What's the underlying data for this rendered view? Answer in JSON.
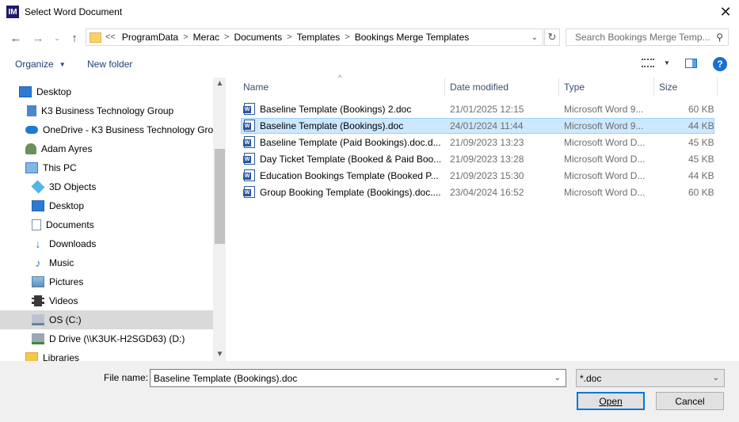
{
  "window": {
    "title": "Select Word Document",
    "app_icon": "IM"
  },
  "address": {
    "overflow": "<<",
    "crumbs": [
      "ProgramData",
      "Merac",
      "Documents",
      "Templates",
      "Bookings Merge Templates"
    ]
  },
  "search": {
    "placeholder": "Search Bookings Merge Temp..."
  },
  "toolbar": {
    "organize": "Organize",
    "new_folder": "New folder",
    "help": "?"
  },
  "nav": {
    "items": [
      {
        "label": "Desktop",
        "icon": "desktop-icon"
      },
      {
        "label": "K3 Business Technology Group",
        "icon": "building-icon"
      },
      {
        "label": "OneDrive - K3 Business Technology Grou",
        "icon": "cloud-icon"
      },
      {
        "label": "Adam Ayres",
        "icon": "user-icon"
      },
      {
        "label": "This PC",
        "icon": "computer-icon"
      },
      {
        "label": "3D Objects",
        "icon": "cube-icon"
      },
      {
        "label": "Desktop",
        "icon": "desktop-icon"
      },
      {
        "label": "Documents",
        "icon": "documents-icon"
      },
      {
        "label": "Downloads",
        "icon": "download-icon"
      },
      {
        "label": "Music",
        "icon": "music-icon"
      },
      {
        "label": "Pictures",
        "icon": "pictures-icon"
      },
      {
        "label": "Videos",
        "icon": "videos-icon"
      },
      {
        "label": "OS (C:)",
        "icon": "drive-icon"
      },
      {
        "label": "D Drive (\\\\K3UK-H2SGD63) (D:)",
        "icon": "network-drive-icon"
      },
      {
        "label": "Libraries",
        "icon": "libraries-icon"
      }
    ]
  },
  "columns": {
    "name": "Name",
    "date": "Date modified",
    "type": "Type",
    "size": "Size"
  },
  "files": [
    {
      "name": "Baseline Template (Bookings) 2.doc",
      "date": "21/01/2025 12:15",
      "type": "Microsoft Word 9...",
      "size": "60 KB"
    },
    {
      "name": "Baseline Template (Bookings).doc",
      "date": "24/01/2024 11:44",
      "type": "Microsoft Word 9...",
      "size": "44 KB"
    },
    {
      "name": "Baseline Template (Paid Bookings).doc.d...",
      "date": "21/09/2023 13:23",
      "type": "Microsoft Word D...",
      "size": "45 KB"
    },
    {
      "name": "Day Ticket Template (Booked & Paid Boo...",
      "date": "21/09/2023 13:28",
      "type": "Microsoft Word D...",
      "size": "45 KB"
    },
    {
      "name": "Education Bookings Template (Booked P...",
      "date": "21/09/2023 15:30",
      "type": "Microsoft Word D...",
      "size": "44 KB"
    },
    {
      "name": "Group Booking Template (Bookings).doc....",
      "date": "23/04/2024 16:52",
      "type": "Microsoft Word D...",
      "size": "60 KB"
    }
  ],
  "footer": {
    "file_name_label": "File name:",
    "file_name_value": "Baseline Template (Bookings).doc",
    "file_type": "*.doc",
    "open": "Open",
    "cancel": "Cancel"
  }
}
